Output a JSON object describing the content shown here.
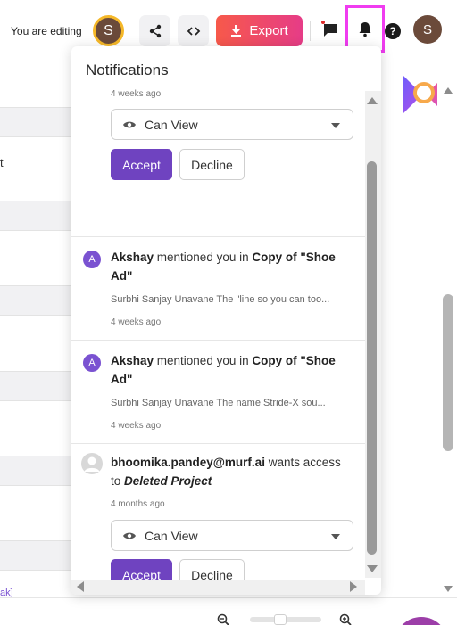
{
  "header": {
    "editing_label": "You are editing",
    "editing_avatar_initial": "S",
    "export_label": "Export",
    "user_avatar_initial": "S",
    "help_label": "?",
    "icons": [
      "share-icon",
      "code-icon",
      "download-icon",
      "chat-icon",
      "bell-icon",
      "help-icon"
    ],
    "colors": {
      "export_gradient_start": "#f7594a",
      "export_gradient_end": "#e63c87",
      "highlight": "#f03cf0"
    }
  },
  "background": {
    "row_letter": "t",
    "link_fragment": "ak]"
  },
  "notifications": {
    "title": "Notifications",
    "items": [
      {
        "time": "4 weeks ago",
        "permission": "Can View",
        "accept": "Accept",
        "decline": "Decline"
      },
      {
        "avatar": "A",
        "actor": "Akshay",
        "action": " mentioned you in ",
        "target": "Copy of \"Shoe Ad\"",
        "snippet": "Surbhi Sanjay Unavane The \"line so you can too...",
        "time": "4 weeks ago"
      },
      {
        "avatar": "A",
        "actor": "Akshay",
        "action": " mentioned you in ",
        "target": "Copy of \"Shoe Ad\"",
        "snippet": "Surbhi Sanjay Unavane The name Stride-X sou...",
        "time": "4 weeks ago"
      },
      {
        "actor": "bhoomika.pandey@murf.ai",
        "action": " wants access to ",
        "target": "Deleted Project",
        "time": "4 months ago",
        "permission": "Can View",
        "accept": "Accept",
        "decline": "Decline"
      }
    ]
  },
  "accent_color": "#6f43c0"
}
